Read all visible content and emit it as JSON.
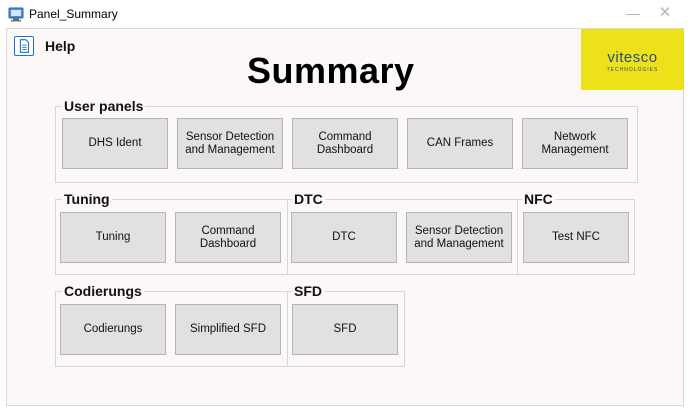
{
  "window": {
    "title": "Panel_Summary",
    "minimize_icon": "minimize-icon",
    "close_icon": "close-icon"
  },
  "menu": {
    "help_icon": "document-icon",
    "help_label": "Help"
  },
  "page_title": "Summary",
  "logo": {
    "main": "vitesco",
    "sub": "TECHNOLOGIES",
    "background": "#ede21a",
    "text_color": "#2a4b7c"
  },
  "groups": {
    "user_panels": {
      "title": "User panels",
      "buttons": [
        "DHS Ident",
        "Sensor Detection and Management",
        "Command Dashboard",
        "CAN Frames",
        "Network Management"
      ]
    },
    "tuning": {
      "title": "Tuning",
      "buttons": [
        "Tuning",
        "Command Dashboard"
      ]
    },
    "dtc": {
      "title": "DTC",
      "buttons": [
        "DTC",
        "Sensor Detection and Management"
      ]
    },
    "nfc": {
      "title": "NFC",
      "buttons": [
        "Test NFC"
      ]
    },
    "codierungs": {
      "title": "Codierungs",
      "buttons": [
        "Codierungs",
        "Simplified SFD"
      ]
    },
    "sfd": {
      "title": "SFD",
      "buttons": [
        "SFD"
      ]
    }
  }
}
